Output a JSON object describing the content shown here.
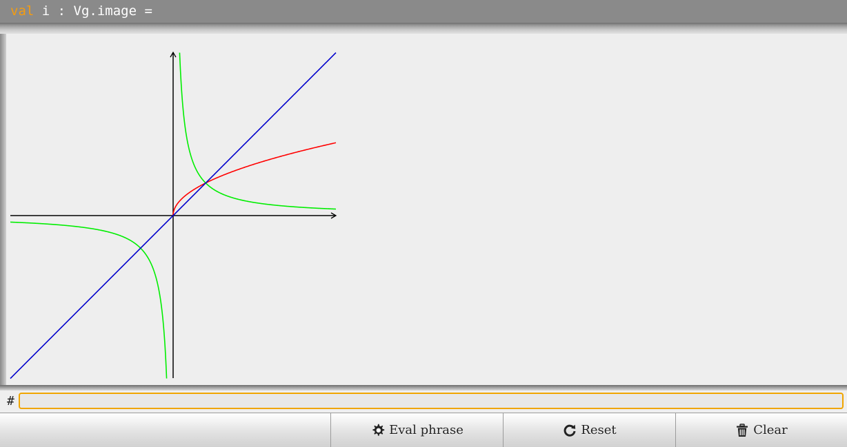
{
  "output": {
    "keyword": "val",
    "rest": " i : Vg.image ="
  },
  "prompt": {
    "symbol": "#",
    "value": ""
  },
  "buttons": {
    "eval_label": "Eval phrase",
    "reset_label": "Reset",
    "clear_label": "Clear"
  },
  "colors": {
    "keyword": "#f39c12",
    "sqrt_curve": "#ff0000",
    "hyperbola": "#00ee00",
    "identity_line": "#0000cc",
    "axes": "#000000",
    "input_border": "#f0a500"
  },
  "icons": {
    "eval": "cog-icon",
    "reset": "refresh-icon",
    "clear": "trash-icon"
  },
  "chart_data": {
    "type": "line",
    "xlim": [
      -5,
      5
    ],
    "ylim": [
      -5,
      5
    ],
    "grid": false,
    "series": [
      {
        "function": "sqrt",
        "color": "#ff0000",
        "x": [
          0,
          0.05,
          0.2,
          0.5,
          1,
          2,
          3,
          4,
          5
        ],
        "y": [
          0,
          0.224,
          0.447,
          0.707,
          1,
          1.414,
          1.732,
          2,
          2.236
        ]
      },
      {
        "function": "reciprocal",
        "color": "#00ee00",
        "x": [
          0.2,
          0.3,
          0.5,
          1,
          2,
          3,
          5
        ],
        "y": [
          5,
          3.33,
          2,
          1,
          0.5,
          0.333,
          0.2
        ]
      },
      {
        "function": "reciprocal",
        "color": "#00ee00",
        "x": [
          -5,
          -3,
          -2,
          -1,
          -0.5,
          -0.3,
          -0.2
        ],
        "y": [
          -0.2,
          -0.333,
          -0.5,
          -1,
          -2,
          -3.33,
          -5
        ]
      },
      {
        "function": "identity",
        "color": "#0000cc",
        "x": [
          -5,
          5
        ],
        "y": [
          -5,
          5
        ]
      }
    ]
  }
}
